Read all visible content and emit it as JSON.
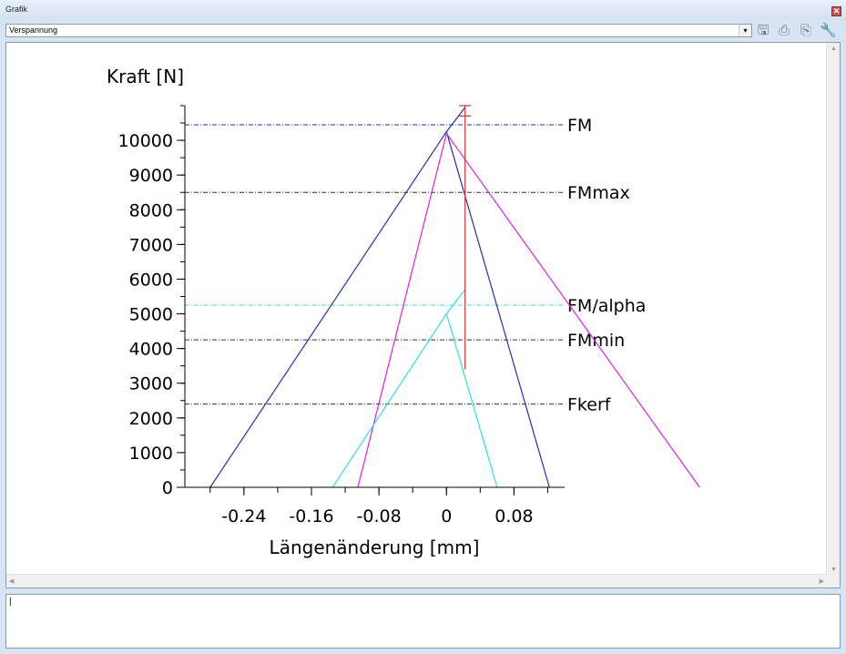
{
  "window": {
    "title": "Grafik",
    "close_glyph": "✕"
  },
  "toolbar": {
    "dropdown_value": "Verspannung",
    "dropdown_arrow": "▾",
    "icons": [
      {
        "name": "save-icon",
        "glyph": "🖫"
      },
      {
        "name": "print-icon",
        "glyph": "⎙"
      },
      {
        "name": "print-preview-icon",
        "glyph": "⎘"
      },
      {
        "name": "settings-icon",
        "glyph": "🔧"
      }
    ]
  },
  "output": {
    "text": "|"
  },
  "chart_data": {
    "type": "line",
    "title": "",
    "xlabel": "Längenänderung [mm]",
    "ylabel": "Kraft [N]",
    "xlim": [
      -0.31,
      0.14
    ],
    "ylim": [
      0,
      11000
    ],
    "x_major_ticks": [
      -0.24,
      -0.16,
      -0.08,
      0,
      0.08
    ],
    "x_tick_labels": [
      "-0.24",
      "-0.16",
      "-0.08",
      "0",
      "0.08"
    ],
    "x_minor_step": 0.04,
    "y_major_ticks": [
      0,
      1000,
      2000,
      3000,
      4000,
      5000,
      6000,
      7000,
      8000,
      9000,
      10000
    ],
    "y_tick_labels": [
      "0",
      "1000",
      "2000",
      "3000",
      "4000",
      "5000",
      "6000",
      "7000",
      "8000",
      "9000",
      "10000"
    ],
    "y_minor_step": 500,
    "grid": false,
    "series": [
      {
        "color": "#2a2ab8",
        "style": "solid",
        "points": [
          [
            -0.28,
            0
          ],
          [
            0,
            10250
          ],
          [
            0.022,
            10950
          ]
        ]
      },
      {
        "color": "#2a2ab8",
        "style": "solid",
        "points": [
          [
            0,
            10250
          ],
          [
            0.122,
            0
          ]
        ]
      },
      {
        "color": "#e020e0",
        "style": "solid",
        "points": [
          [
            -0.105,
            0
          ],
          [
            0,
            10200
          ],
          [
            0.3,
            0
          ]
        ]
      },
      {
        "color": "#30e0e0",
        "style": "solid",
        "points": [
          [
            -0.135,
            0
          ],
          [
            0,
            5000
          ],
          [
            0.022,
            5700
          ]
        ]
      },
      {
        "color": "#30e0e0",
        "style": "solid",
        "points": [
          [
            0,
            5000
          ],
          [
            0.06,
            0
          ]
        ]
      },
      {
        "color": "#e03030",
        "style": "solid",
        "points": [
          [
            0.022,
            3400
          ],
          [
            0.022,
            11000
          ]
        ]
      },
      {
        "color": "#e03030",
        "style": "solid",
        "points": [
          [
            0.015,
            11000
          ],
          [
            0.029,
            11000
          ]
        ]
      },
      {
        "color": "#e03030",
        "style": "solid",
        "points": [
          [
            0.015,
            10700
          ],
          [
            0.029,
            10700
          ]
        ]
      }
    ],
    "reference_lines": [
      {
        "label": "FM",
        "y": 10450,
        "color": "#2a2ab8"
      },
      {
        "label": "FMmax",
        "y": 8500,
        "color": "#333333"
      },
      {
        "label": "FM/alpha",
        "y": 5250,
        "color": "#30d8e8"
      },
      {
        "label": "FMmin",
        "y": 4250,
        "color": "#333333"
      },
      {
        "label": "Fkerf",
        "y": 2400,
        "color": "#333333"
      }
    ]
  }
}
